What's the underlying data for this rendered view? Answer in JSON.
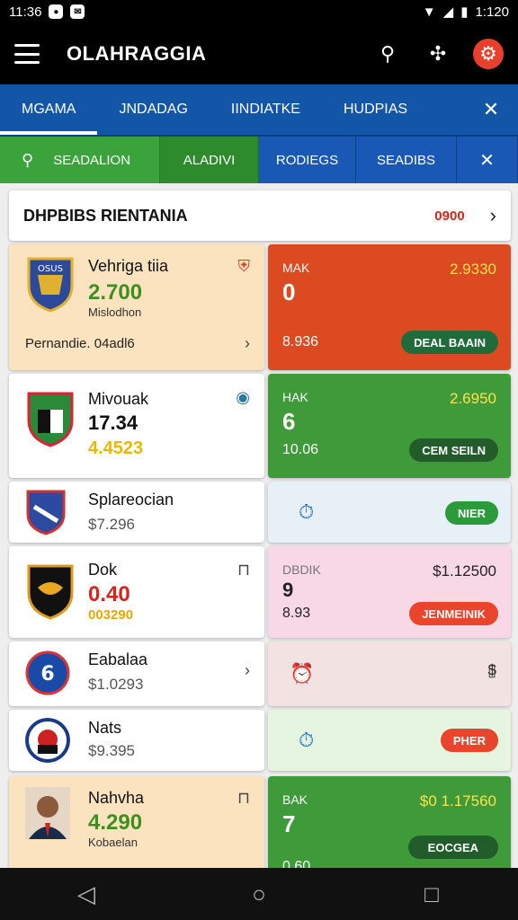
{
  "status": {
    "time": "11:36",
    "right_time": "1:120"
  },
  "appbar": {
    "title": "OLAHRAGGIA"
  },
  "tabs": [
    {
      "label": "MGAMA",
      "active": true
    },
    {
      "label": "JNDADAG",
      "active": false
    },
    {
      "label": "IINDIATKE",
      "active": false
    },
    {
      "label": "HUDPIAS",
      "active": false
    }
  ],
  "filters": {
    "search": "SEADALION",
    "chip1": "ALADIVI",
    "chip2": "RODIEGS",
    "chip3": "SEADIBS"
  },
  "header": {
    "title": "DHPBIBS RIENTANIA",
    "count": "0900"
  },
  "rows": [
    {
      "name": "Vehriga tiia",
      "value": "2.700",
      "sub": "Mislodhon",
      "footer": "Pernandie. 04adl6",
      "right": {
        "label": "MAK",
        "big": "0",
        "small": "8.936",
        "odds": "2.9330",
        "button": "DEAL BAAIN"
      }
    },
    {
      "name": "Mivouak",
      "value": "17.34",
      "value2": "4.4523",
      "right": {
        "label": "HAK",
        "big": "6",
        "small": "10.06",
        "odds": "2.6950",
        "button": "CEM SEILN"
      }
    },
    {
      "name": "Splareocian",
      "sub": "$7.296",
      "right": {
        "button": "NIER"
      }
    },
    {
      "name": "Dok",
      "value": "0.40",
      "value2": "003290",
      "right": {
        "label": "DBDIK",
        "big": "9",
        "small": "8.93",
        "odds": "$1.12500",
        "button": "JENMEINIK"
      }
    },
    {
      "name": "Eabalaa",
      "sub": "$1.0293",
      "right": {
        "odds": "$"
      }
    },
    {
      "name": "Nats",
      "sub": "$9.395",
      "right": {
        "button": "PHER"
      }
    },
    {
      "name": "Nahvha",
      "value": "4.290",
      "sub": "Kobaelan",
      "right": {
        "label": "BAK",
        "big": "7",
        "small": "0.60",
        "odds": "$0 1.17560",
        "button": "EOCGEA"
      }
    }
  ],
  "colors": {
    "appbar": "#000000",
    "tabs": "#1356a8",
    "accent_green": "#3ba33b",
    "accent_red": "#d6261b"
  }
}
